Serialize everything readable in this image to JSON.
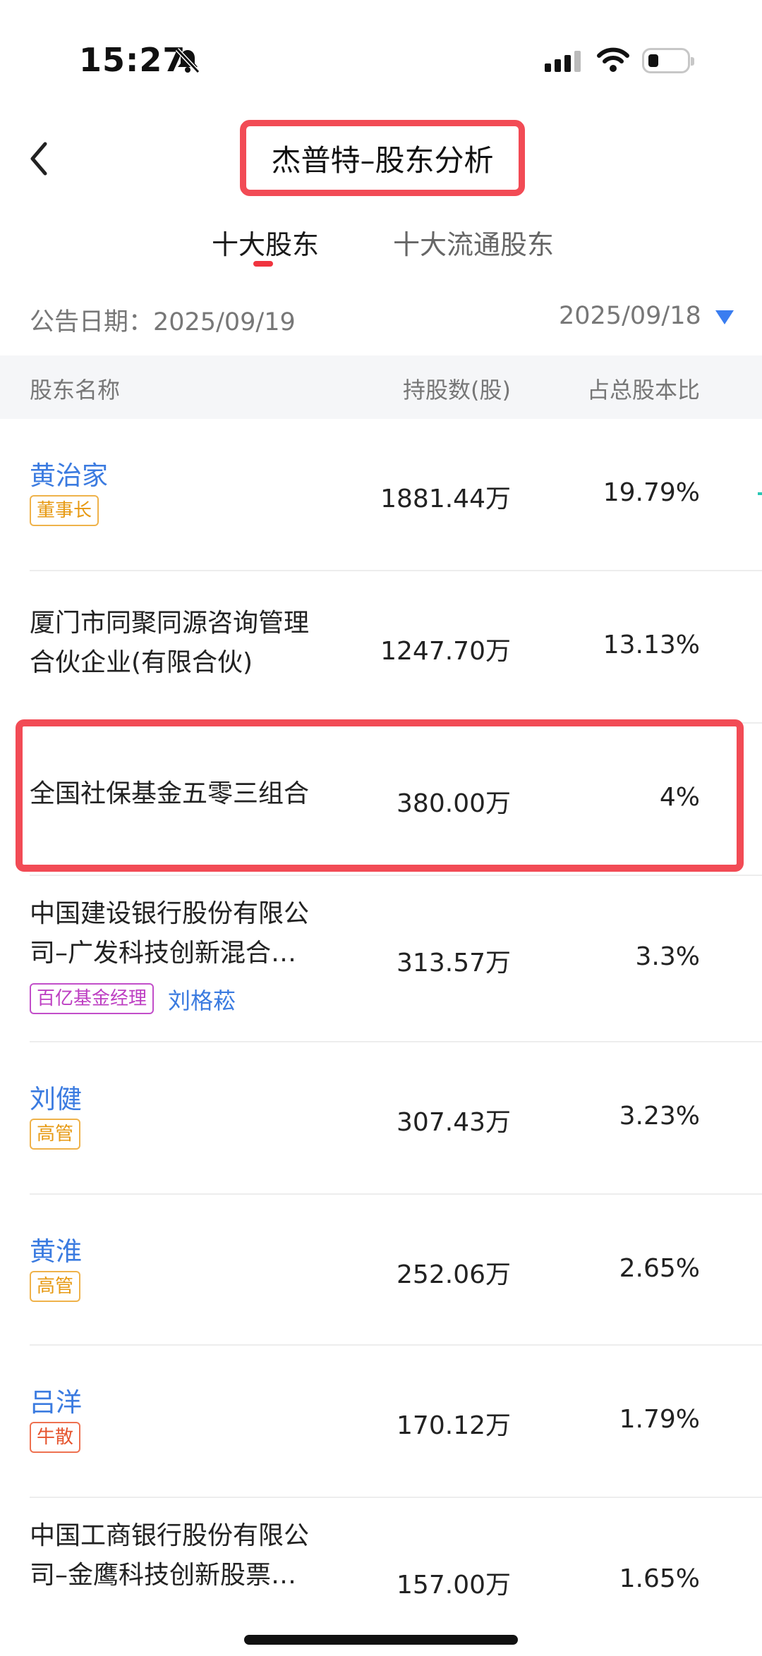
{
  "status_bar": {
    "time": "15:27"
  },
  "header": {
    "title": "杰普特–股东分析"
  },
  "tabs": [
    {
      "label": "十大股东",
      "active": true
    },
    {
      "label": "十大流通股东",
      "active": false
    }
  ],
  "announcement": {
    "label": "公告日期：2025/09/19",
    "selected_date": "2025/09/18"
  },
  "table": {
    "columns": [
      "股东名称",
      "持股数(股)",
      "占总股本比"
    ],
    "rows": [
      {
        "name": "黄治家",
        "name_lines": [
          "黄治家"
        ],
        "tag": "董事长",
        "shares": "1881.44万",
        "ratio": "19.79%"
      },
      {
        "name_lines": [
          "厦门市同聚同源咨询管理",
          "合伙企业(有限合伙)"
        ],
        "shares": "1247.70万",
        "ratio": "13.13%"
      },
      {
        "name_lines": [
          "全国社保基金五零三组合"
        ],
        "shares": "380.00万",
        "ratio": "4%"
      },
      {
        "name_lines": [
          "中国建设银行股份有限公",
          "司–广发科技创新混合…"
        ],
        "tag": "百亿基金经理",
        "manager": "刘格菘",
        "shares": "313.57万",
        "ratio": "3.3%"
      },
      {
        "name_lines": [
          "刘健"
        ],
        "tag": "高管",
        "shares": "307.43万",
        "ratio": "3.23%"
      },
      {
        "name_lines": [
          "黄淮"
        ],
        "tag": "高管",
        "shares": "252.06万",
        "ratio": "2.65%"
      },
      {
        "name_lines": [
          "吕洋"
        ],
        "tag": "牛散",
        "shares": "170.12万",
        "ratio": "1.79%"
      },
      {
        "name_lines": [
          "中国工商银行股份有限公",
          "司–金鹰科技创新股票…"
        ],
        "shares": "157.00万",
        "ratio": "1.65%"
      }
    ]
  },
  "colors": {
    "accent_red": "#f24b55",
    "link_blue": "#3b7be0",
    "tag_gold": "#e79a13",
    "tag_red": "#e5542e",
    "tag_purple": "#bd3ec2"
  }
}
